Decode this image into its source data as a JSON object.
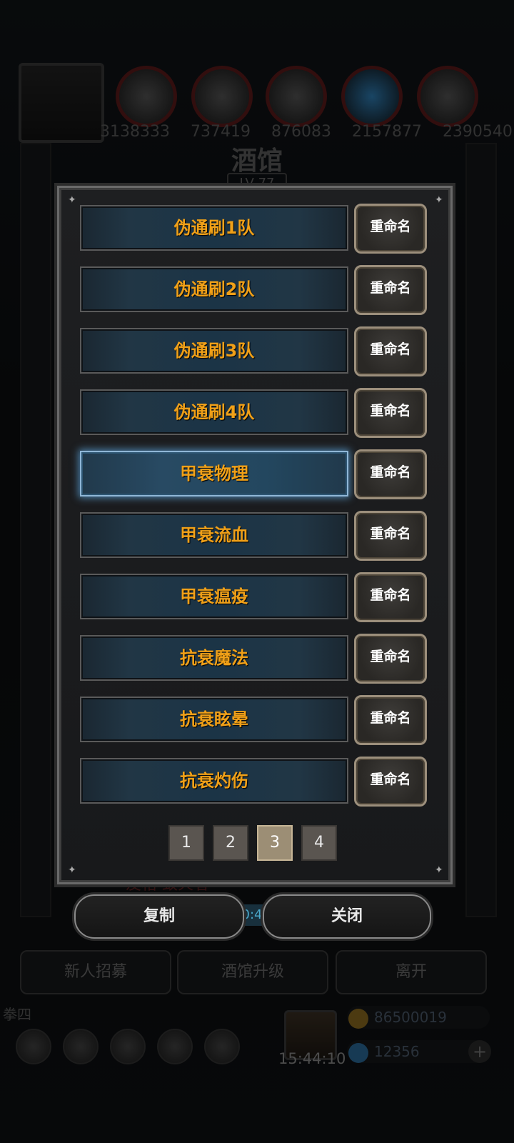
{
  "background": {
    "resources": [
      "3138333",
      "737419",
      "876083",
      "2157877",
      "2390540"
    ],
    "tavern_title": "酒馆",
    "tavern_level": "LV 77",
    "bottom_buttons": [
      "新人招募",
      "酒馆升级",
      "离开"
    ],
    "player_name": "拳四",
    "clock": "15:44:10",
    "gold": "86500019",
    "gems": "12356",
    "hint_text": "0:4",
    "side_label": "友格·致火者"
  },
  "modal": {
    "teams": [
      {
        "label": "伪通刷1队",
        "rename": "重命名"
      },
      {
        "label": "伪通刷2队",
        "rename": "重命名"
      },
      {
        "label": "伪通刷3队",
        "rename": "重命名"
      },
      {
        "label": "伪通刷4队",
        "rename": "重命名"
      },
      {
        "label": "甲衰物理",
        "rename": "重命名"
      },
      {
        "label": "甲衰流血",
        "rename": "重命名"
      },
      {
        "label": "甲衰瘟疫",
        "rename": "重命名"
      },
      {
        "label": "抗衰魔法",
        "rename": "重命名"
      },
      {
        "label": "抗衰眩晕",
        "rename": "重命名"
      },
      {
        "label": "抗衰灼伤",
        "rename": "重命名"
      }
    ],
    "selected_index": 4,
    "pages": [
      "1",
      "2",
      "3",
      "4"
    ],
    "current_page": "3",
    "copy_label": "复制",
    "close_label": "关闭"
  },
  "colors": {
    "team_label": "#f0a018",
    "selected_border": "#8fb6d6",
    "active_page": "#9c8e75"
  },
  "icons": [
    "character-avatar",
    "meat-resource-icon",
    "wood-resource-icon",
    "iron-resource-icon",
    "crystal-resource-icon",
    "stone-resource-icon",
    "gift-icon",
    "gold-coin-icon",
    "gem-icon",
    "plus-icon"
  ]
}
